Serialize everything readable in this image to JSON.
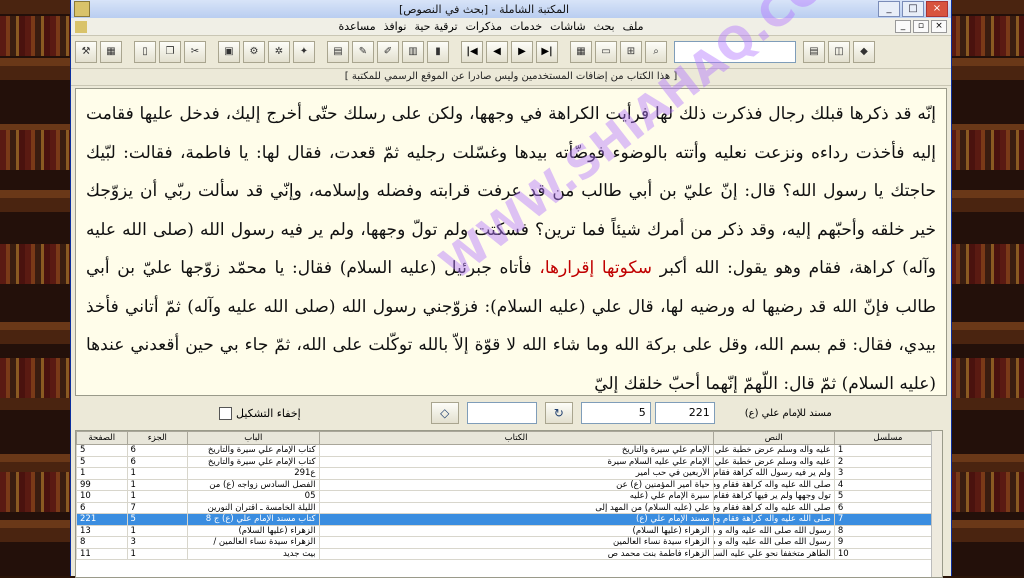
{
  "window": {
    "title": "المكتبة الشاملة - [بحث في النصوص]",
    "minimize": "_",
    "maximize": "□",
    "close": "×"
  },
  "menu": {
    "items": [
      "ملف",
      "بحث",
      "شاشات",
      "خدمات",
      "مذكرات",
      "ترقية حية",
      "نوافذ",
      "مساعدة"
    ],
    "mdi_min": "_",
    "mdi_restore": "▫",
    "mdi_close": "×"
  },
  "toolbar": {
    "left_icons": [
      "tools-icon",
      "calculator-icon",
      "page-icon",
      "copy-icon",
      "scissors-icon",
      "box-icon",
      "gear-icon",
      "settings-icon",
      "star-icon",
      "image-icon",
      "pencil-icon",
      "brush-icon",
      "table-icon",
      "book-icon"
    ],
    "nav": [
      "|◀",
      "◀",
      "▶",
      "▶|"
    ],
    "right_icons": [
      "library-icon",
      "folder-icon",
      "cart-icon",
      "search-icon",
      "books-icon",
      "open-book-icon",
      "green-book-icon"
    ]
  },
  "notice": "[ هذا الكتاب من إضافات المستخدمين وليس صادرا عن الموقع الرسمي للمكتبة ]",
  "text": {
    "part1": "إنّه قد ذكرها قبلك رجال فذكرت ذلك لها فرأيت الكراهة في وجهها، ولكن على رسلك حتّى أخرج إليك، فدخل عليها فقامت إليه فأخذت رداءه ونزعت نعليه وأتته بالوضوء فوضّأته بيدها وغسّلت رجليه ثمّ قعدت، فقال لها: يا فاطمة، فقالت: لبّيك حاجتك يا رسول الله؟ قال: إنّ عليّ بن أبي طالب من قد عرفت قرابته وفضله وإسلامه، وإنّي قد سألت ربّي أن يزوّجك خير خلقه وأحبّهم إليه، وقد ذكر من أمرك شيئاً فما ترين؟ فسكتت ولم تولّ وجهها، ولم ير فيه رسول الله (صلى الله عليه وآله) كراهة، فقام وهو يقول: الله أكبر ",
    "highlight": "سكوتها إقرارها،",
    "part2": " فأتاه جبرئيل (عليه السلام) فقال: يا محمّد زوّجها عليّ بن أبي طالب فإنّ الله قد رضيها له ورضيه لها، قال علي (عليه السلام): فزوّجني رسول الله (صلى الله عليه وآله) ثمّ أتاني فأخذ بيدي، فقال: قم بسم الله، وقل على بركة الله وما شاء الله لا قوّة إلاّ بالله توكّلت على الله، ثمّ جاء بي حين أقعدني عندها (عليه السلام) ثمّ قال: اللّهمّ إنّهما أحبّ خلقك إليّ"
  },
  "watermark": "WWW.SHIAHAQ.COM",
  "controls": {
    "book_label": "مسند للإمام علي (ع)",
    "page": "221",
    "part": "5",
    "refresh_glyph": "↻",
    "hide_diacritics": "إخفاء التشكيل"
  },
  "table": {
    "headers": [
      "مسلسل",
      "النص",
      "الكتاب",
      "الباب",
      "الجزء",
      "الصفحة"
    ],
    "rows": [
      [
        "1",
        "عليه وآله وسلم عرض خطبة علي على فاطمة فقال لها إن عليا يذكرك فسكتت فخرج يقول سكوتها",
        "الإمام علي سيرة والتاريخ",
        "كتاب الإمام علي سيرة والتاريخ",
        "6",
        "5"
      ],
      [
        "2",
        "عليه وآله وسلم عرض خطبة علي على فاطمة فقال لها إن عليا يذكرك فسكتت فخرج يقول سكوتها",
        "الإمام علي عليه السلام سيرة",
        "كتاب الإمام علي سيرة والتاريخ",
        "6",
        "5"
      ],
      [
        "3",
        "ولم ير فيه رسول الله كراهة فقام وهو يقول الله أكبر سكوتها إقرارها وأتاه جبرئيل فقال يا محمد",
        "الأربعين في حب أمير",
        "ع291",
        "1",
        "1"
      ],
      [
        "4",
        "صلى الله عليه وآله كراهة فقام وهو يقول الله أكبر سكوتها إقرارها فأتاه جبرئيل عليه السلام",
        "حياة أمير المؤمنين (ع) عن",
        "الفصل السادس زواجه (ع) من",
        "1",
        "99"
      ],
      [
        "5",
        "تول وجهها ولم ير فيها كراهة فقام وهو يقول الله أكبر سكوتها إقرارها فهبط علي عليه السلام إلى",
        "سيرة الإمام علي (عليه",
        "05",
        "1",
        "10"
      ],
      [
        "6",
        "صلى الله عليه وآله كراهة فقام وهو يقول الله أكبر سكوتها إقرارها فهبط علي عليه السلام إلى المسجد وجاء",
        "علي (عليه السلام) من المهد إلى",
        "الليلة الخامسة ـ اقتران النورين",
        "7",
        "6"
      ],
      [
        "7",
        "صلى الله عليه وآله كراهة فقام وهو يقول الله أكبر سكوتها إقرارها فأتاه جبرئيل عليه السلام",
        "مسند الإمام علي (ع)",
        "كتاب مسند الإمام علي (ع) ج 8",
        "5",
        "221"
      ],
      [
        "8",
        "رسول الله صلى الله عليه وآله و هو يقول الله أكبر سكوتها إقرارها بعدها ثم عقد القران بواسطة",
        "الزهراء (عليها السلام)",
        "الزهراء (عليها السلام)",
        "1",
        "13"
      ],
      [
        "9",
        "رسول الله صلى الله عليه وآله و هو يقول الله أكبر سكوتها إقرارها بعدها ثم عقد القران بواسطة",
        "الزهراء سيدة نساء العالمين",
        "الزهراء سيدة نساء العالمين /",
        "3",
        "8"
      ],
      [
        "10",
        "الطاهر متخففا نحو علي عليه السلام وهو يقول الله أكبر سكوتها إقرارها قال إن الله اشار هذا الحديث",
        "الزهراء فاطمة بنت محمد ص",
        "بيت جديد",
        "1",
        "11"
      ]
    ],
    "selected_index": 6
  }
}
